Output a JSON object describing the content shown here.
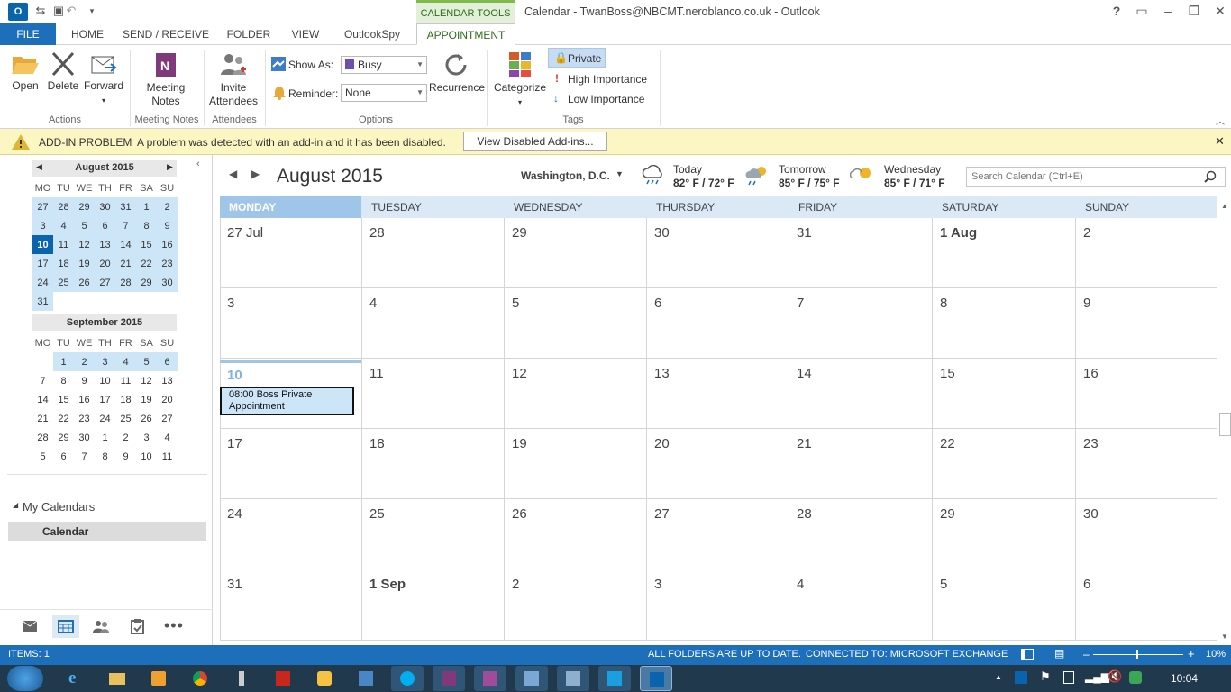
{
  "titlebar": {
    "title": "Calendar - TwanBoss@NBCMT.neroblanco.co.uk - Outlook",
    "context_tab": "CALENDAR TOOLS",
    "help": "?"
  },
  "tabs": [
    {
      "label": "FILE"
    },
    {
      "label": "HOME"
    },
    {
      "label": "SEND / RECEIVE"
    },
    {
      "label": "FOLDER"
    },
    {
      "label": "VIEW"
    },
    {
      "label": "OutlookSpy"
    },
    {
      "label": "APPOINTMENT"
    }
  ],
  "ribbon": {
    "open": "Open",
    "delete": "Delete",
    "forward": "Forward",
    "meeting_notes_1": "Meeting",
    "meeting_notes_2": "Notes",
    "invite_1": "Invite",
    "invite_2": "Attendees",
    "show_as_label": "Show As:",
    "show_as_value": "Busy",
    "reminder_label": "Reminder:",
    "reminder_value": "None",
    "recurrence": "Recurrence",
    "categorize": "Categorize",
    "private": "Private",
    "high_importance": "High Importance",
    "low_importance": "Low Importance",
    "groups": {
      "actions": "Actions",
      "meeting_notes": "Meeting Notes",
      "attendees": "Attendees",
      "options": "Options",
      "tags": "Tags"
    }
  },
  "addin_bar": {
    "title": "ADD-IN PROBLEM",
    "message": "A problem was detected with an add-in and it has been disabled.",
    "button": "View Disabled Add-ins...",
    "close": "✕"
  },
  "nav": {
    "aug_title": "August 2015",
    "sep_title": "September 2015",
    "weekdays": [
      "MO",
      "TU",
      "WE",
      "TH",
      "FR",
      "SA",
      "SU"
    ],
    "aug_weeks": [
      [
        "27",
        "28",
        "29",
        "30",
        "31",
        "1",
        "2"
      ],
      [
        "3",
        "4",
        "5",
        "6",
        "7",
        "8",
        "9"
      ],
      [
        "10",
        "11",
        "12",
        "13",
        "14",
        "15",
        "16"
      ],
      [
        "17",
        "18",
        "19",
        "20",
        "21",
        "22",
        "23"
      ],
      [
        "24",
        "25",
        "26",
        "27",
        "28",
        "29",
        "30"
      ],
      [
        "31",
        "",
        "",
        "",
        "",
        "",
        ""
      ]
    ],
    "sep_weeks": [
      [
        "",
        "1",
        "2",
        "3",
        "4",
        "5",
        "6"
      ],
      [
        "7",
        "8",
        "9",
        "10",
        "11",
        "12",
        "13"
      ],
      [
        "14",
        "15",
        "16",
        "17",
        "18",
        "19",
        "20"
      ],
      [
        "21",
        "22",
        "23",
        "24",
        "25",
        "26",
        "27"
      ],
      [
        "28",
        "29",
        "30",
        "1",
        "2",
        "3",
        "4"
      ],
      [
        "5",
        "6",
        "7",
        "8",
        "9",
        "10",
        "11"
      ]
    ],
    "my_calendars": "My Calendars",
    "calendar": "Calendar"
  },
  "calendar": {
    "month_title": "August 2015",
    "location": "Washington, D.C.",
    "weather": [
      {
        "day": "Today",
        "temp": "82° F / 72° F"
      },
      {
        "day": "Tomorrow",
        "temp": "85° F / 75° F"
      },
      {
        "day": "Wednesday",
        "temp": "85° F / 71° F"
      }
    ],
    "search_placeholder": "Search Calendar (Ctrl+E)",
    "weekdays": [
      "MONDAY",
      "TUESDAY",
      "WEDNESDAY",
      "THURSDAY",
      "FRIDAY",
      "SATURDAY",
      "SUNDAY"
    ],
    "weeks": [
      [
        "27 Jul",
        "28",
        "29",
        "30",
        "31",
        "1 Aug",
        "2"
      ],
      [
        "3",
        "4",
        "5",
        "6",
        "7",
        "8",
        "9"
      ],
      [
        "10",
        "11",
        "12",
        "13",
        "14",
        "15",
        "16"
      ],
      [
        "17",
        "18",
        "19",
        "20",
        "21",
        "22",
        "23"
      ],
      [
        "24",
        "25",
        "26",
        "27",
        "28",
        "29",
        "30"
      ],
      [
        "31",
        "1 Sep",
        "2",
        "3",
        "4",
        "5",
        "6"
      ]
    ],
    "appointment": "08:00 Boss Private Appointment"
  },
  "status": {
    "items": "ITEMS: 1",
    "sync": "ALL FOLDERS ARE UP TO DATE.",
    "connection": "CONNECTED TO: MICROSOFT EXCHANGE",
    "zoom": "10%"
  },
  "taskbar": {
    "time": "10:04"
  }
}
